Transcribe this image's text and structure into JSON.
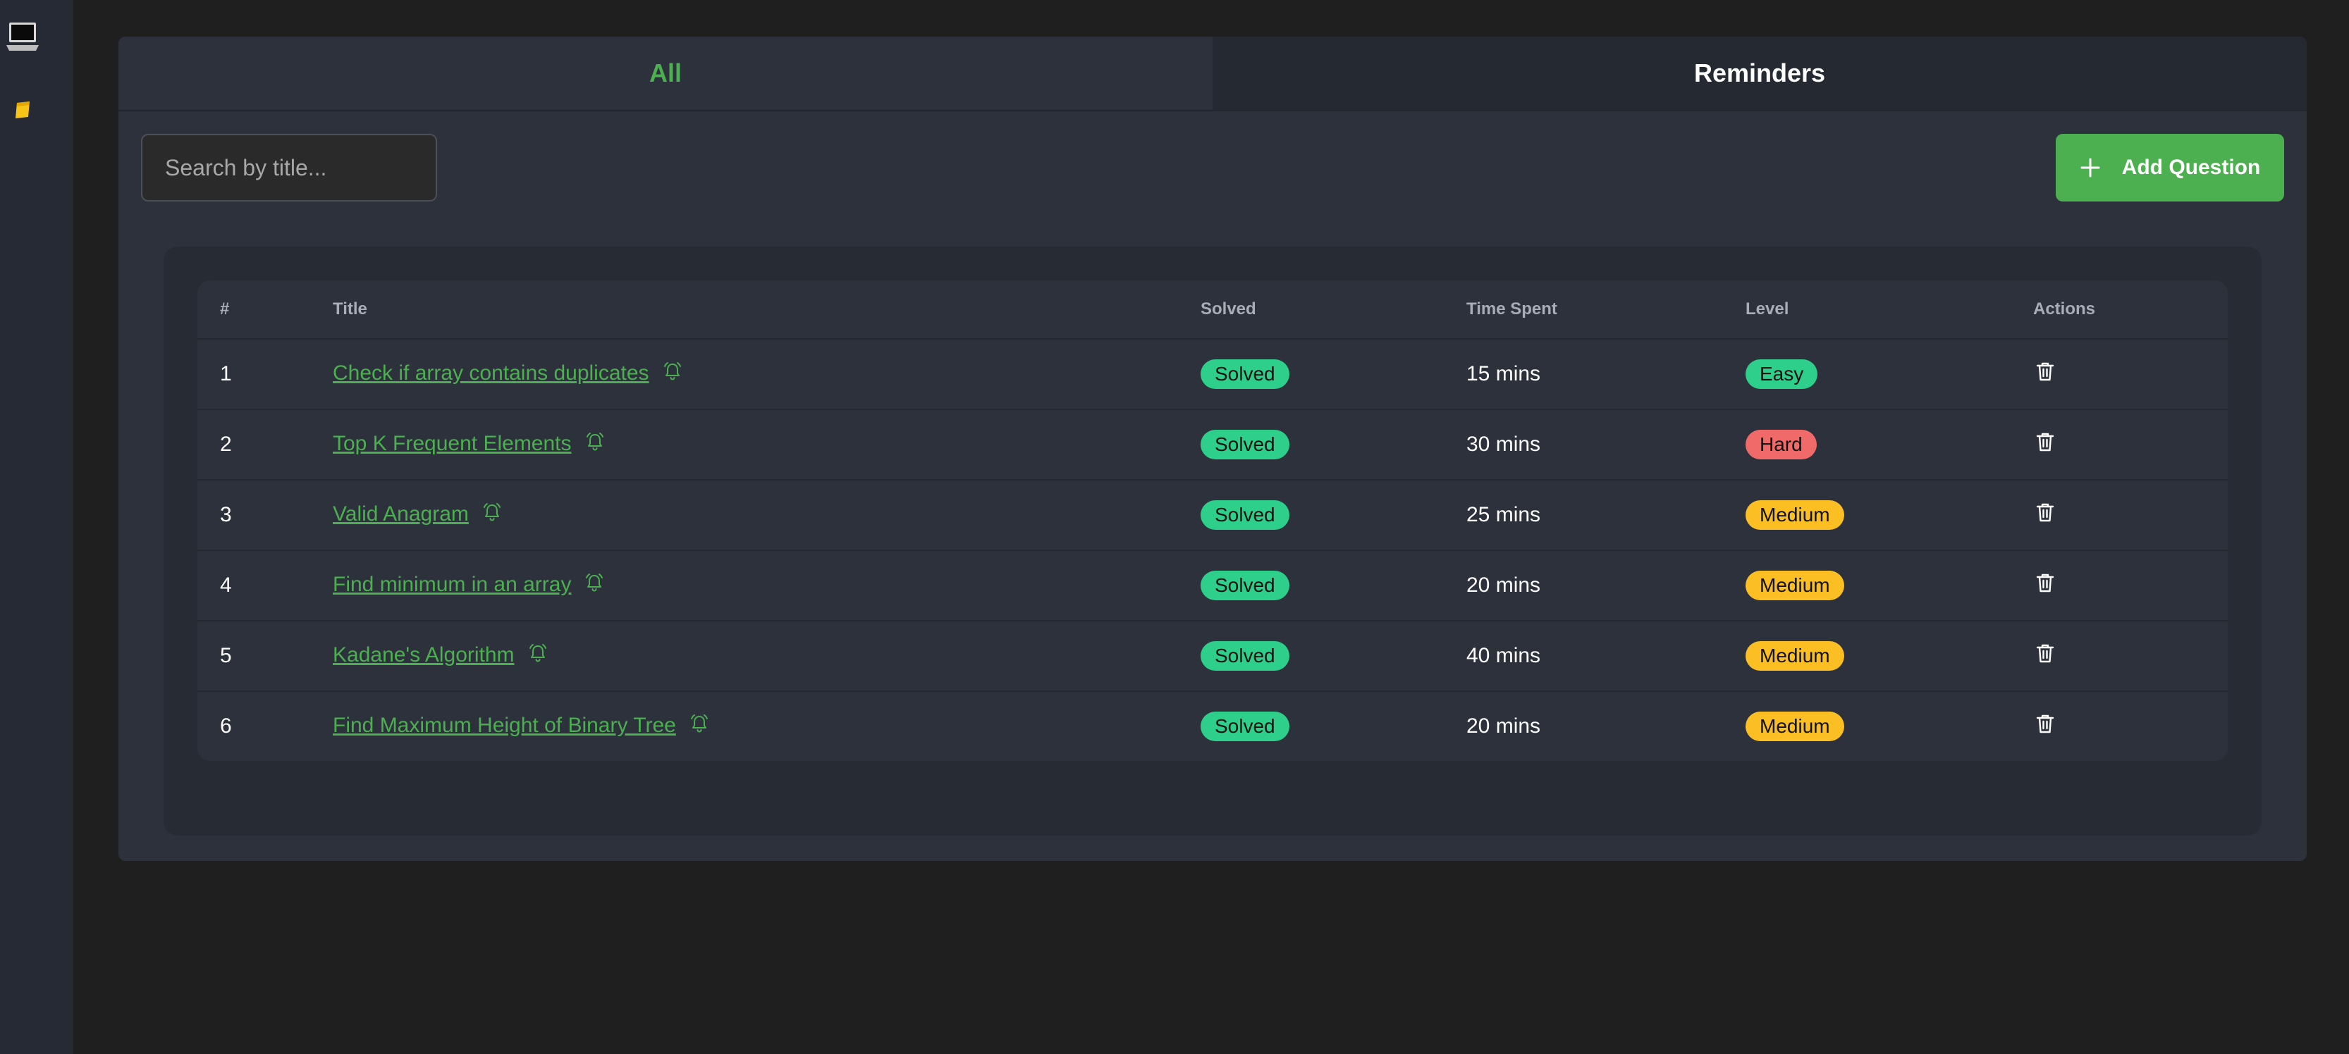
{
  "tabs": [
    {
      "label": "All",
      "active": true
    },
    {
      "label": "Reminders",
      "active": false
    }
  ],
  "search": {
    "placeholder": "Search by title...",
    "value": ""
  },
  "add_button": {
    "icon": "plus-icon",
    "label": "Add Question"
  },
  "table": {
    "headers": [
      "#",
      "Title",
      "Solved",
      "Time Spent",
      "Level",
      "Actions"
    ],
    "rows": [
      {
        "num": "1",
        "title": "Check if array contains duplicates",
        "solved": "Solved",
        "time": "15 mins",
        "level": "Easy"
      },
      {
        "num": "2",
        "title": "Top K Frequent Elements",
        "solved": "Solved",
        "time": "30 mins",
        "level": "Hard"
      },
      {
        "num": "3",
        "title": "Valid Anagram",
        "solved": "Solved",
        "time": "25 mins",
        "level": "Medium"
      },
      {
        "num": "4",
        "title": "Find minimum in an array",
        "solved": "Solved",
        "time": "20 mins",
        "level": "Medium"
      },
      {
        "num": "5",
        "title": "Kadane's Algorithm",
        "solved": "Solved",
        "time": "40 mins",
        "level": "Medium"
      },
      {
        "num": "6",
        "title": "Find Maximum Height of Binary Tree",
        "solved": "Solved",
        "time": "20 mins",
        "level": "Medium"
      }
    ]
  },
  "colors": {
    "accent": "#4cb050",
    "solved": "#2dcf8a",
    "easy": "#2dcf8a",
    "hard": "#f06a6a",
    "medium": "#fbbf24"
  },
  "icons": {
    "sidebar": [
      "laptop-icon",
      "notes-icon"
    ],
    "row_reminder": "bell-icon",
    "row_action": "trash-icon"
  }
}
